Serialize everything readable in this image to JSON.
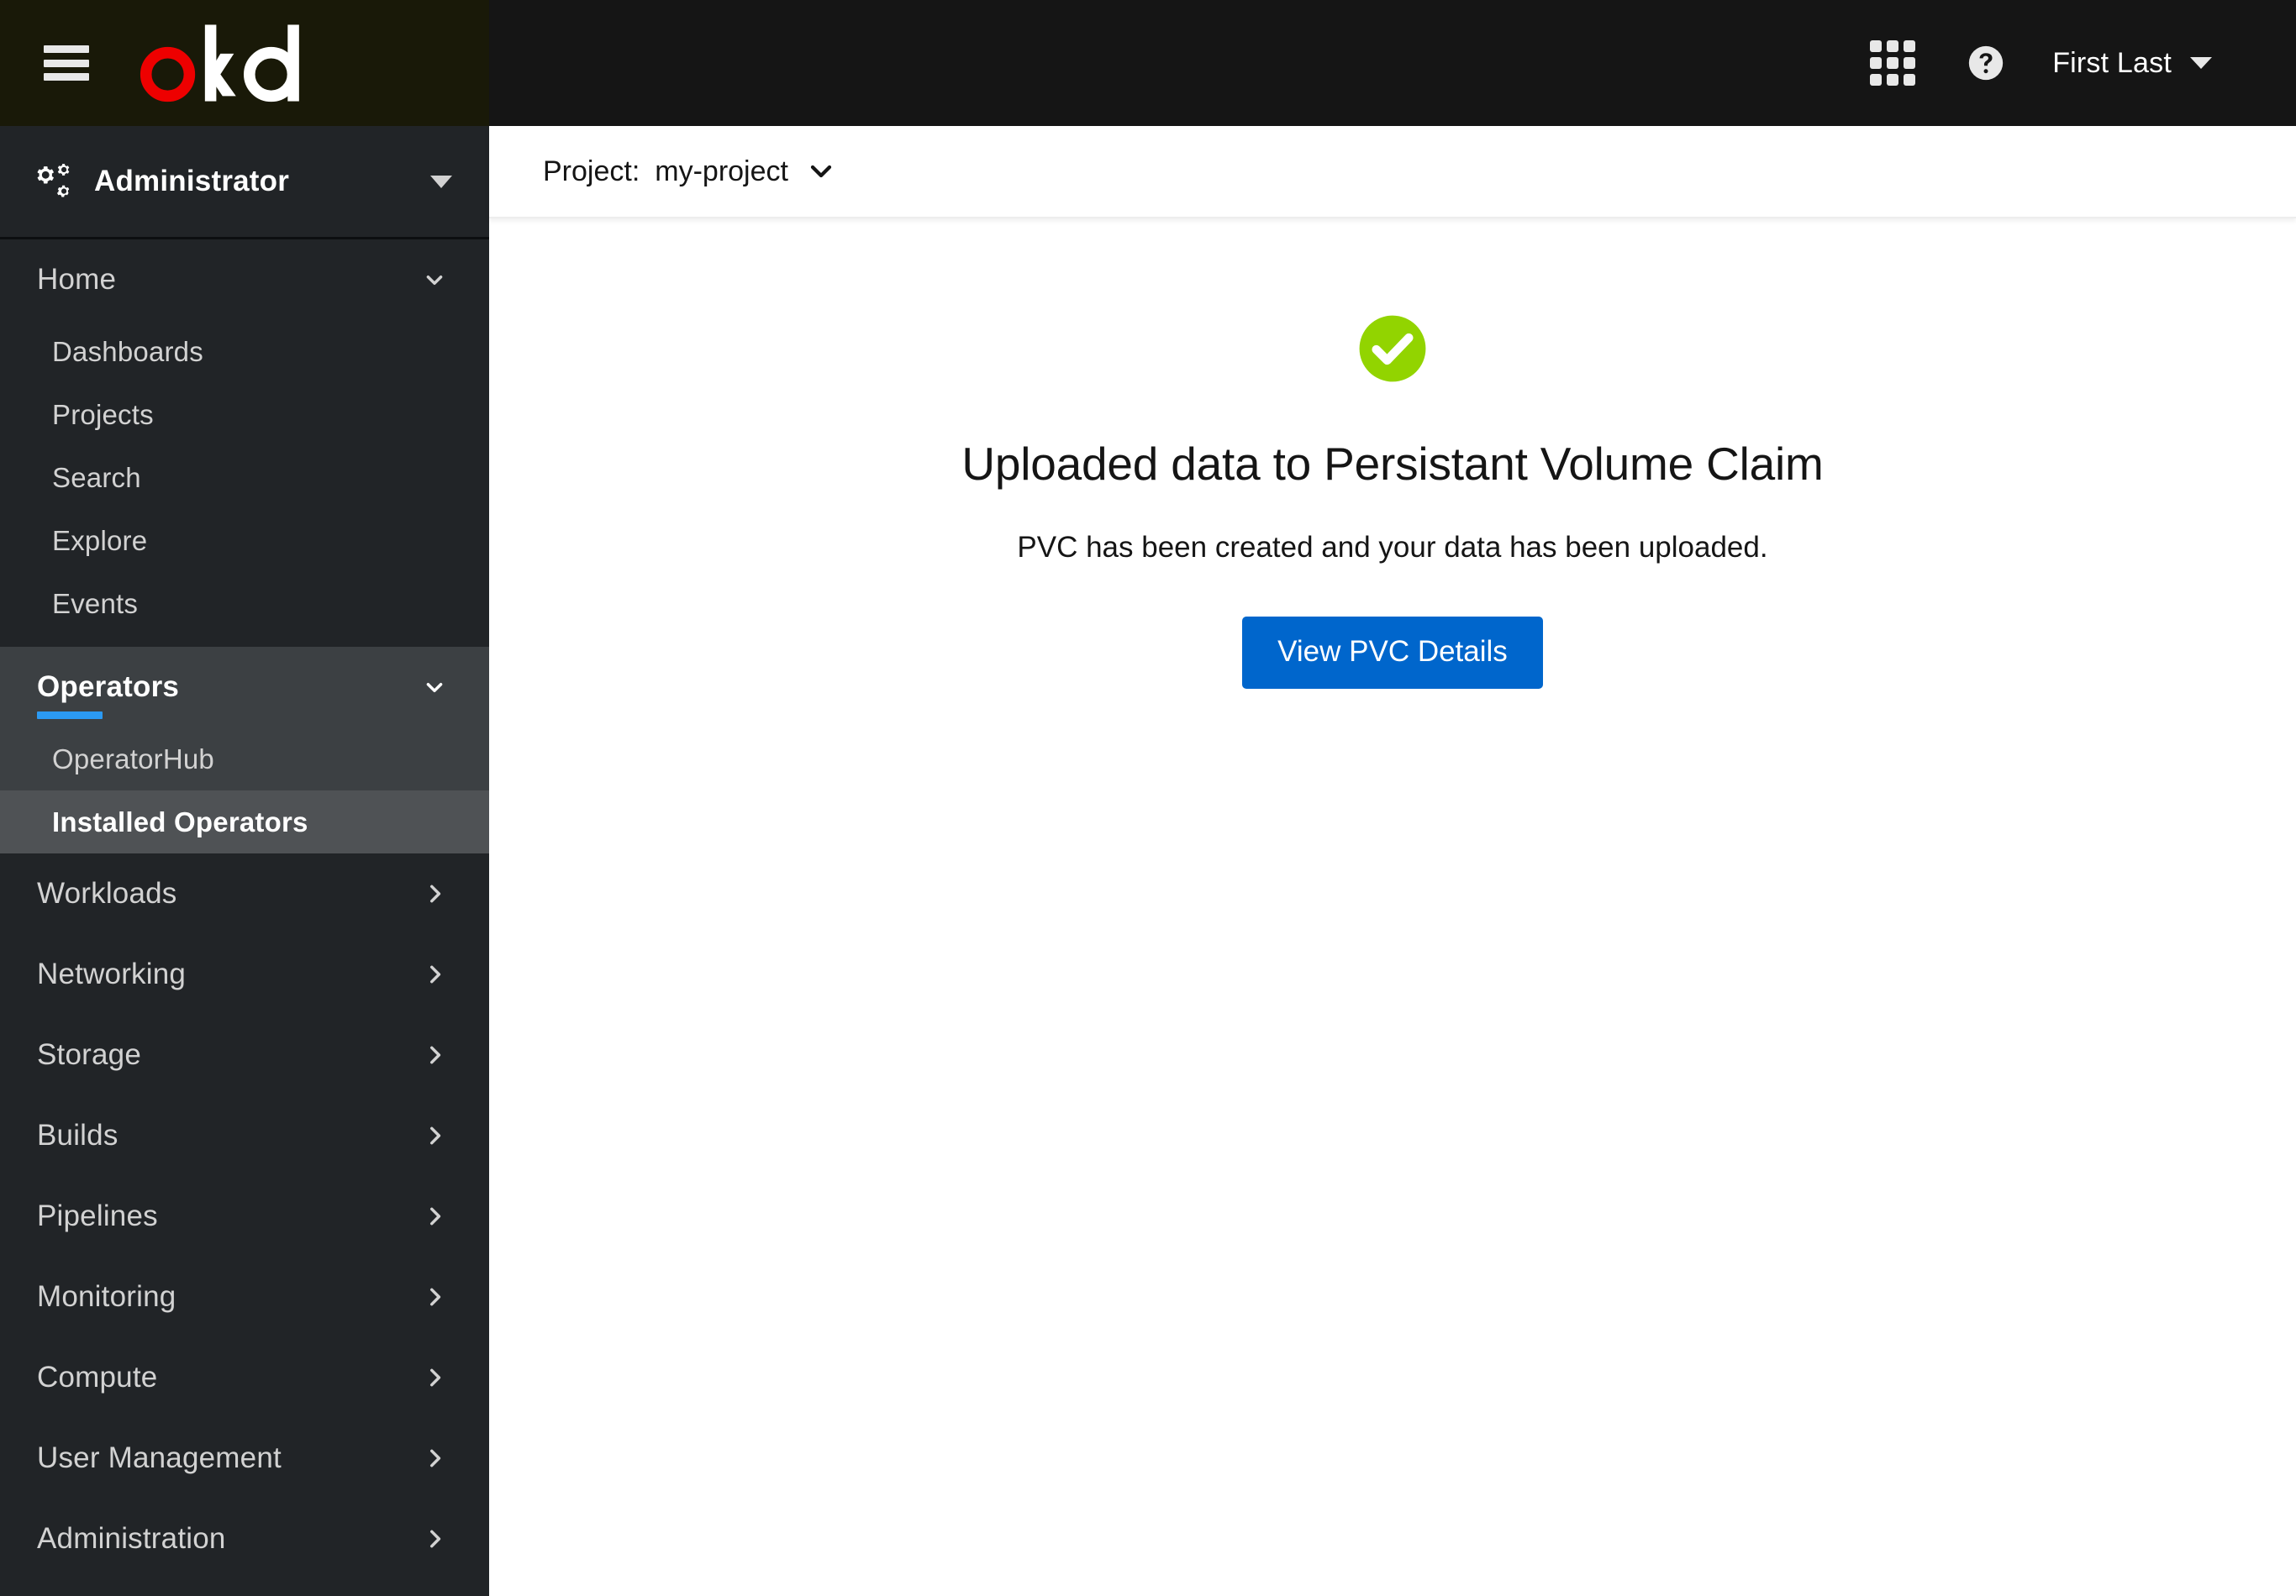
{
  "masthead": {
    "brand_name": "okd",
    "hamburger_label": "Toggle navigation",
    "apps_label": "Application launcher",
    "help_label": "Help",
    "user_name": "First Last",
    "brand_accent_color": "#ee0000",
    "background_color": "#151515",
    "brand_background_color": "#191908"
  },
  "sidebar": {
    "perspective": {
      "label": "Administrator",
      "icon": "cogs-icon"
    },
    "sections": [
      {
        "label": "Home",
        "expanded": true,
        "highlighted": false,
        "items": [
          {
            "label": "Dashboards",
            "active": false
          },
          {
            "label": "Projects",
            "active": false
          },
          {
            "label": "Search",
            "active": false
          },
          {
            "label": "Explore",
            "active": false
          },
          {
            "label": "Events",
            "active": false
          }
        ]
      },
      {
        "label": "Operators",
        "expanded": true,
        "highlighted": true,
        "items": [
          {
            "label": "OperatorHub",
            "active": false
          },
          {
            "label": "Installed Operators",
            "active": true
          }
        ]
      },
      {
        "label": "Workloads",
        "expanded": false,
        "highlighted": false,
        "items": []
      },
      {
        "label": "Networking",
        "expanded": false,
        "highlighted": false,
        "items": []
      },
      {
        "label": "Storage",
        "expanded": false,
        "highlighted": false,
        "items": []
      },
      {
        "label": "Builds",
        "expanded": false,
        "highlighted": false,
        "items": []
      },
      {
        "label": "Pipelines",
        "expanded": false,
        "highlighted": false,
        "items": []
      },
      {
        "label": "Monitoring",
        "expanded": false,
        "highlighted": false,
        "items": []
      },
      {
        "label": "Compute",
        "expanded": false,
        "highlighted": false,
        "items": []
      },
      {
        "label": "User Management",
        "expanded": false,
        "highlighted": false,
        "items": []
      },
      {
        "label": "Administration",
        "expanded": false,
        "highlighted": false,
        "items": []
      }
    ],
    "background_color": "#212427",
    "active_item_color": "#4f5255",
    "accent_color": "#2b9af3"
  },
  "project_bar": {
    "label": "Project:",
    "value": "my-project",
    "chevron_icon": "chevron-down-icon"
  },
  "main": {
    "status_icon": "check-circle-icon",
    "status_icon_color": "#92d400",
    "title": "Uploaded data to Persistant Volume Claim",
    "description": "PVC has been created and your data has been uploaded.",
    "action_button": "View PVC Details",
    "action_button_color": "#0066cc"
  }
}
